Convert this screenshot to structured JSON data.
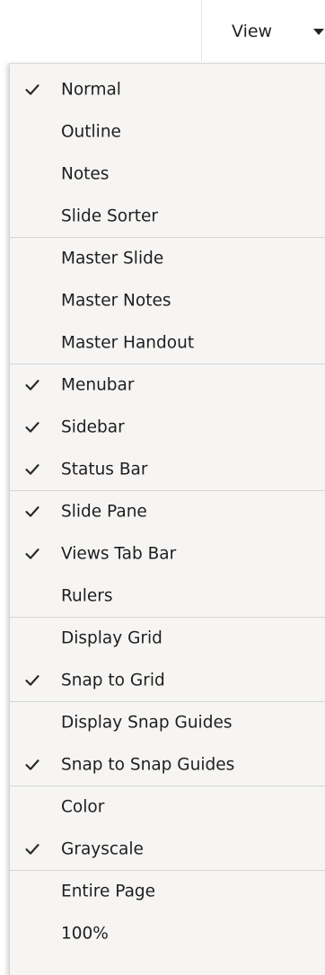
{
  "topbar": {
    "view_label": "View"
  },
  "menu": {
    "items": [
      {
        "label": "Normal",
        "checked": true,
        "sep_before": false
      },
      {
        "label": "Outline",
        "checked": false,
        "sep_before": false
      },
      {
        "label": "Notes",
        "checked": false,
        "sep_before": false
      },
      {
        "label": "Slide Sorter",
        "checked": false,
        "sep_before": false
      },
      {
        "label": "Master Slide",
        "checked": false,
        "sep_before": true
      },
      {
        "label": "Master Notes",
        "checked": false,
        "sep_before": false
      },
      {
        "label": "Master Handout",
        "checked": false,
        "sep_before": false
      },
      {
        "label": "Menubar",
        "checked": true,
        "sep_before": true
      },
      {
        "label": "Sidebar",
        "checked": true,
        "sep_before": false
      },
      {
        "label": "Status Bar",
        "checked": true,
        "sep_before": false
      },
      {
        "label": "Slide Pane",
        "checked": true,
        "sep_before": true
      },
      {
        "label": "Views Tab Bar",
        "checked": true,
        "sep_before": false
      },
      {
        "label": "Rulers",
        "checked": false,
        "sep_before": false
      },
      {
        "label": "Display Grid",
        "checked": false,
        "sep_before": true
      },
      {
        "label": "Snap to Grid",
        "checked": true,
        "sep_before": false
      },
      {
        "label": "Display Snap Guides",
        "checked": false,
        "sep_before": true
      },
      {
        "label": "Snap to Snap Guides",
        "checked": true,
        "sep_before": false
      },
      {
        "label": "Color",
        "checked": false,
        "sep_before": true
      },
      {
        "label": "Grayscale",
        "checked": true,
        "sep_before": false
      },
      {
        "label": "Entire Page",
        "checked": false,
        "sep_before": true
      },
      {
        "label": "100%",
        "checked": false,
        "sep_before": false
      }
    ]
  }
}
